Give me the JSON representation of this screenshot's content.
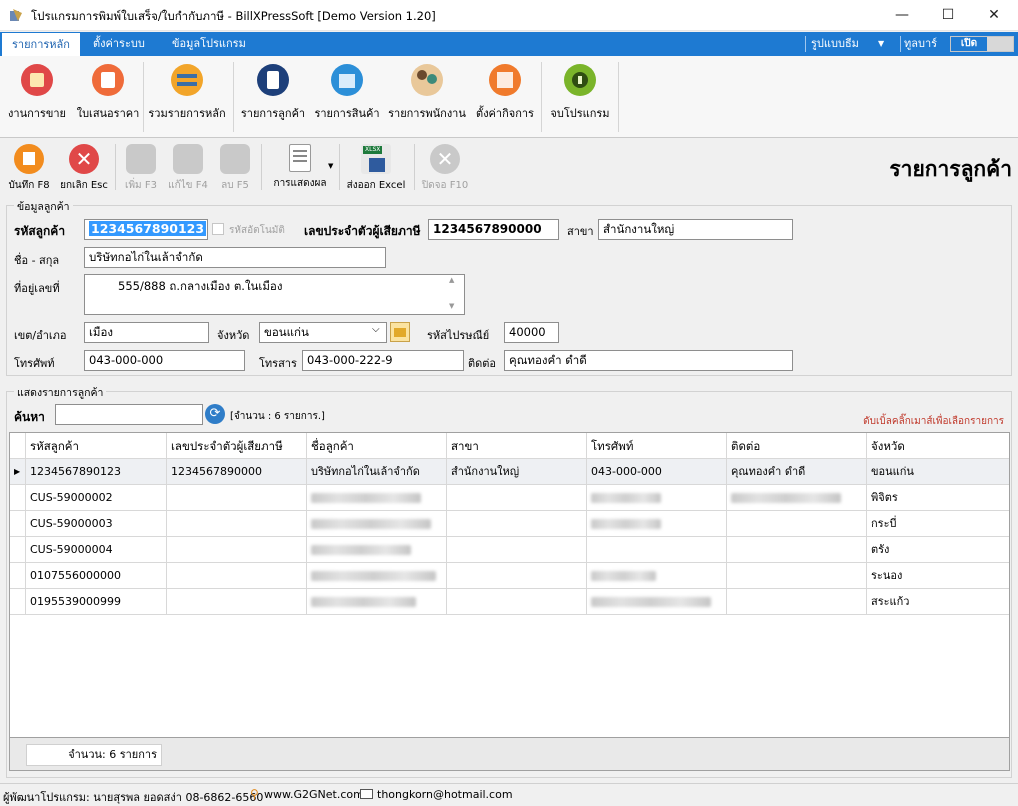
{
  "window": {
    "title": "โปรแกรมการพิมพ์ใบเสร็จ/ใบกำกับภาษี - BillXPressSoft [Demo Version 1.20]",
    "minimize": "—",
    "maximize": "☐",
    "close": "✕"
  },
  "tabs": [
    "รายการหลัก",
    "ตั้งค่าระบบ",
    "ข้อมูลโปรแกรม"
  ],
  "tab_right": {
    "theme": "รูปแบบธีม",
    "toolbar": "ทูลบาร์",
    "toggle": "เปิด"
  },
  "ribbon": [
    {
      "label": "งานการขาย",
      "icon": "sales-icon",
      "color": "#e04848"
    },
    {
      "label": "ใบเสนอราคา",
      "icon": "quotation-icon",
      "color": "#ef6b3a"
    },
    {
      "label": "รวมรายการหลัก",
      "icon": "transfer-icon",
      "color": "#f2a52a"
    },
    {
      "label": "รายการลูกค้า",
      "icon": "customer-list-icon",
      "color": "#1d3f7a"
    },
    {
      "label": "รายการสินค้า",
      "icon": "products-icon",
      "color": "#2c8fd8"
    },
    {
      "label": "รายการพนักงาน",
      "icon": "employees-icon",
      "color": "#e0a35a"
    },
    {
      "label": "ตั้งค่ากิจการ",
      "icon": "company-settings-icon",
      "color": "#f07a2c"
    },
    {
      "label": "จบโปรแกรม",
      "icon": "power-icon",
      "color": "#7ab42a"
    }
  ],
  "toolbar": {
    "save": "บันทึก F8",
    "cancel": "ยกเลิก Esc",
    "add": "เพิ่ม F3",
    "edit": "แก้ไข F4",
    "delete": "ลบ F5",
    "display": "การแสดงผล",
    "export": "ส่งออก Excel",
    "close": "ปิดจอ F10",
    "export_badge": "XLSX"
  },
  "page_title": "รายการลูกค้า",
  "customer_form": {
    "group_title": "ข้อมูลลูกค้า",
    "code_label": "รหัสลูกค้า",
    "code_value": "1234567890123",
    "auto_code_label": "รหัสอัตโนมัติ",
    "tax_id_label": "เลขประจำตัวผู้เสียภาษี",
    "tax_id_value": "1234567890000",
    "branch_label": "สาขา",
    "branch_value": "สำนักงานใหญ่",
    "name_label": "ชื่อ - สกุล",
    "name_value": "บริษัทกอไก่ในเล้าจำกัด",
    "address_label": "ที่อยู่เลขที่",
    "address_value": "555/888 ถ.กลางเมือง ต.ในเมือง",
    "district_label": "เขต/อำเภอ",
    "district_value": "เมือง",
    "province_label": "จังหวัด",
    "province_value": "ขอนแก่น",
    "postcode_label": "รหัสไปรษณีย์",
    "postcode_value": "40000",
    "phone_label": "โทรศัพท์",
    "phone_value": "043-000-000",
    "fax_label": "โทรสาร",
    "fax_value": "043-000-222-9",
    "contact_label": "ติดต่อ",
    "contact_value": "คุณทองคำ ดำดี"
  },
  "list": {
    "group_title": "แสดงรายการลูกค้า",
    "search_label": "ค้นหา",
    "search_value": "",
    "count_text": "[จำนวน : 6 รายการ.]",
    "hint": "ดับเบิ้ลคลิ๊กเมาส์เพื่อเลือกรายการ",
    "columns": [
      "รหัสลูกค้า",
      "เลขประจำตัวผู้เสียภาษี",
      "ชื่อลูกค้า",
      "สาขา",
      "โทรศัพท์",
      "ติดต่อ",
      "จังหวัด"
    ],
    "rows": [
      {
        "code": "1234567890123",
        "tax": "1234567890000",
        "name": "บริษัทกอไก่ในเล้าจำกัด",
        "branch": "สำนักงานใหญ่",
        "phone": "043-000-000",
        "contact": "คุณทองคำ ดำดี",
        "province": "ขอนแก่น"
      },
      {
        "code": "CUS-59000002",
        "tax": "",
        "name": "",
        "branch": "",
        "phone": "",
        "contact": "",
        "province": "พิจิตร"
      },
      {
        "code": "CUS-59000003",
        "tax": "",
        "name": "",
        "branch": "",
        "phone": "",
        "contact": "",
        "province": "กระบี่"
      },
      {
        "code": "CUS-59000004",
        "tax": "",
        "name": "",
        "branch": "",
        "phone": "",
        "contact": "",
        "province": "ตรัง"
      },
      {
        "code": "0107556000000",
        "tax": "",
        "name": "",
        "branch": "",
        "phone": "",
        "contact": "",
        "province": "ระนอง"
      },
      {
        "code": "0195539000999",
        "tax": "",
        "name": "",
        "branch": "",
        "phone": "",
        "contact": "",
        "province": "สระแก้ว"
      }
    ],
    "footer_count": "จำนวน: 6 รายการ"
  },
  "statusbar": {
    "developer": "ผู้พัฒนาโปรแกรม: นายสุรพล ยอดสง่า 08-6862-6560",
    "website": "www.G2GNet.com",
    "email": "thongkorn@hotmail.com"
  }
}
